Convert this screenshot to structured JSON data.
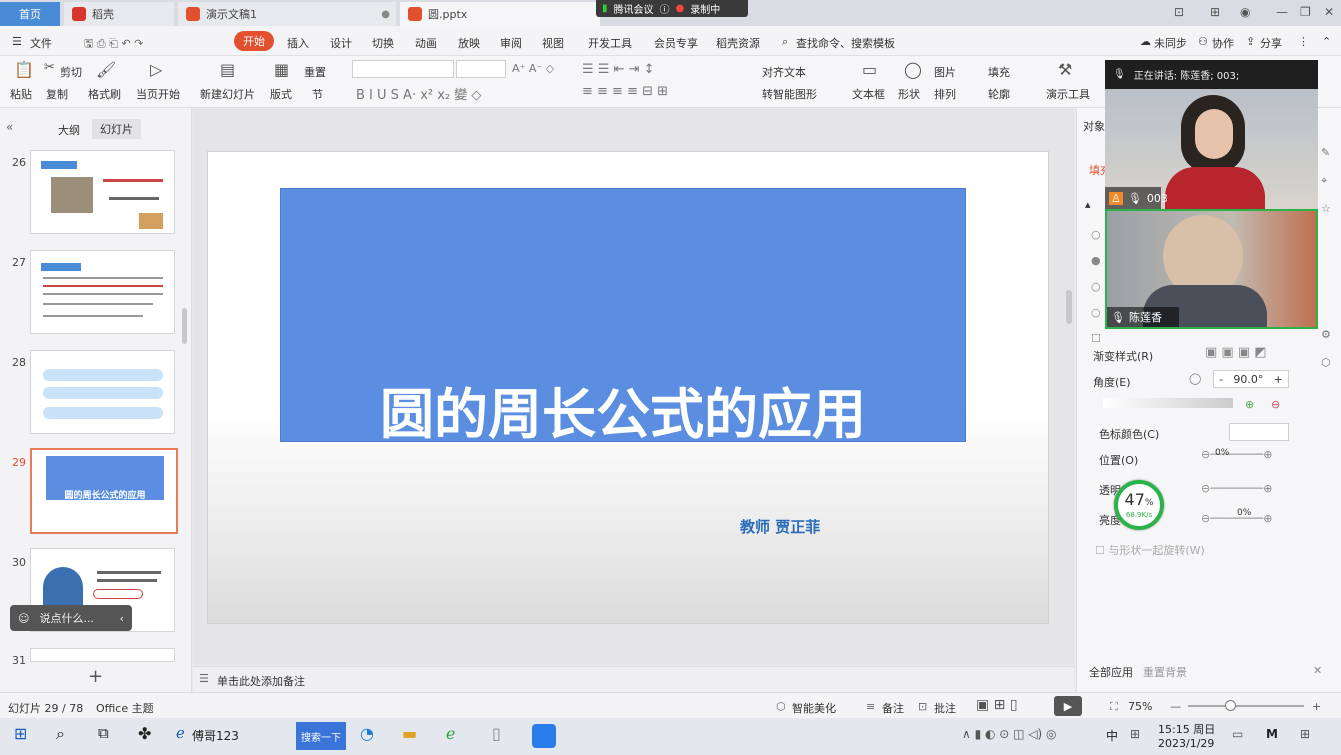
{
  "tabs": {
    "home": "首页",
    "docer": "稻壳",
    "deck1": "演示文稿1",
    "active": "圆.pptx"
  },
  "meeting": {
    "app": "腾讯会议",
    "recording": "录制中"
  },
  "menu": {
    "file": "文件",
    "items": [
      "开始",
      "插入",
      "设计",
      "切换",
      "动画",
      "放映",
      "审阅",
      "视图",
      "开发工具",
      "会员专享",
      "稻壳资源"
    ],
    "search": "查找命令、搜索模板",
    "sync": "未同步",
    "collab": "协作",
    "share": "分享"
  },
  "ribbon": {
    "paste": "粘贴",
    "cut": "剪切",
    "copy": "复制",
    "format_painter": "格式刷",
    "from_start": "当页开始",
    "new_slide": "新建幻灯片",
    "layout": "版式",
    "section": "节",
    "reset": "重置",
    "align_text": "对齐文本",
    "smartart": "转智能图形",
    "textbox": "文本框",
    "shape": "形状",
    "picture": "图片",
    "fill": "填充",
    "arrange": "排列",
    "outline": "轮廓",
    "presenter": "演示工具"
  },
  "left_panel": {
    "tab_outline": "大纲",
    "tab_slides": "幻灯片",
    "slide_numbers": [
      "26",
      "27",
      "28",
      "29",
      "30",
      "31"
    ],
    "thumb_29_title": "圆的周长公式的应用",
    "comment_prompt": "说点什么..."
  },
  "slide": {
    "title": "圆的周长公式的应用",
    "teacher": "教师  贾正菲",
    "notes_placeholder": "单击此处添加备注"
  },
  "right_panel": {
    "header": "对象属性",
    "fill_tab": "填充",
    "gradient_style": "渐变样式(R)",
    "angle": "角度(E)",
    "angle_value": "90.0°",
    "color_stop": "色标颜色(C)",
    "position": "位置(O)",
    "position_value": "0%",
    "transparency": "透明度",
    "brightness": "亮度",
    "brightness_value": "0%",
    "rotate_with_shape": "与形状一起旋转(W)",
    "apply_all": "全部应用",
    "reset_bg": "重置背景"
  },
  "video": {
    "speaking": "正在讲话: 陈莲香; 003;",
    "person1": "003",
    "person2": "陈莲香"
  },
  "net_meter": {
    "percent": "47",
    "unit": "%",
    "speed": "68.9K/s"
  },
  "status": {
    "slide_count": "幻灯片 29 / 78",
    "theme": "Office 主题",
    "smart_beautify": "智能美化",
    "notes": "备注",
    "comment": "批注",
    "zoom": "75%"
  },
  "taskbar": {
    "browser_tab": "傅哥123",
    "search": "搜索一下",
    "ime": "中",
    "time": "15:15 周日",
    "date": "2023/1/29"
  },
  "colors": {
    "accent": "#e2502f",
    "slide_box": "#5b8ee0",
    "teacher": "#2a6cb7"
  }
}
